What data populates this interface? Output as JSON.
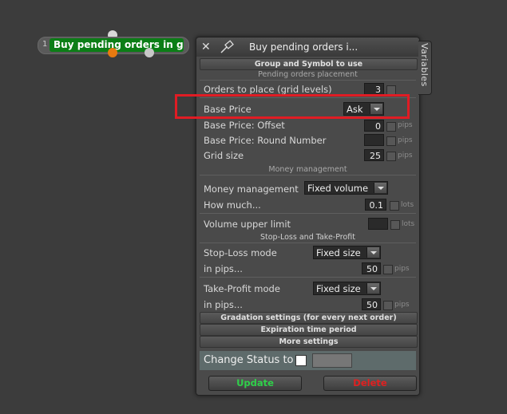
{
  "node": {
    "number": "1",
    "label": "Buy pending orders in grid"
  },
  "panel": {
    "title": "Buy pending orders i...",
    "vars_tab": "Variables",
    "sections": {
      "group_symbol": "Group and Symbol to use",
      "pending_placement": "Pending orders placement",
      "money_management": "Money management",
      "sl_tp": "Stop-Loss and Take-Profit",
      "gradation": "Gradation settings (for every next order)",
      "expiration": "Expiration time period",
      "more": "More settings"
    },
    "fields": {
      "orders_to_place": {
        "label": "Orders to place (grid levels)",
        "value": "3"
      },
      "base_price": {
        "label": "Base Price",
        "value": "Ask"
      },
      "base_price_offset": {
        "label": "Base Price: Offset",
        "value": "0",
        "unit": "pips"
      },
      "base_price_round": {
        "label": "Base Price: Round Number",
        "value": "",
        "unit": "pips"
      },
      "grid_size": {
        "label": "Grid size",
        "value": "25",
        "unit": "pips"
      },
      "money_management": {
        "label": "Money management",
        "value": "Fixed volume"
      },
      "how_much": {
        "label": "How much...",
        "value": "0.1",
        "unit": "lots"
      },
      "volume_upper_limit": {
        "label": "Volume upper limit",
        "value": "",
        "unit": "lots"
      },
      "sl_mode": {
        "label": "Stop-Loss mode",
        "value": "Fixed size"
      },
      "sl_pips": {
        "label": "in pips...",
        "value": "50",
        "unit": "pips"
      },
      "tp_mode": {
        "label": "Take-Profit mode",
        "value": "Fixed size"
      },
      "tp_pips": {
        "label": "in pips...",
        "value": "50",
        "unit": "pips"
      }
    },
    "status": {
      "label": "Change Status to"
    },
    "buttons": {
      "update": "Update",
      "delete": "Delete"
    }
  },
  "colors": {
    "node_green": "#0b7d16",
    "update_text": "#2fd04a",
    "delete_text": "#e02020",
    "highlight": "#e01c24"
  }
}
